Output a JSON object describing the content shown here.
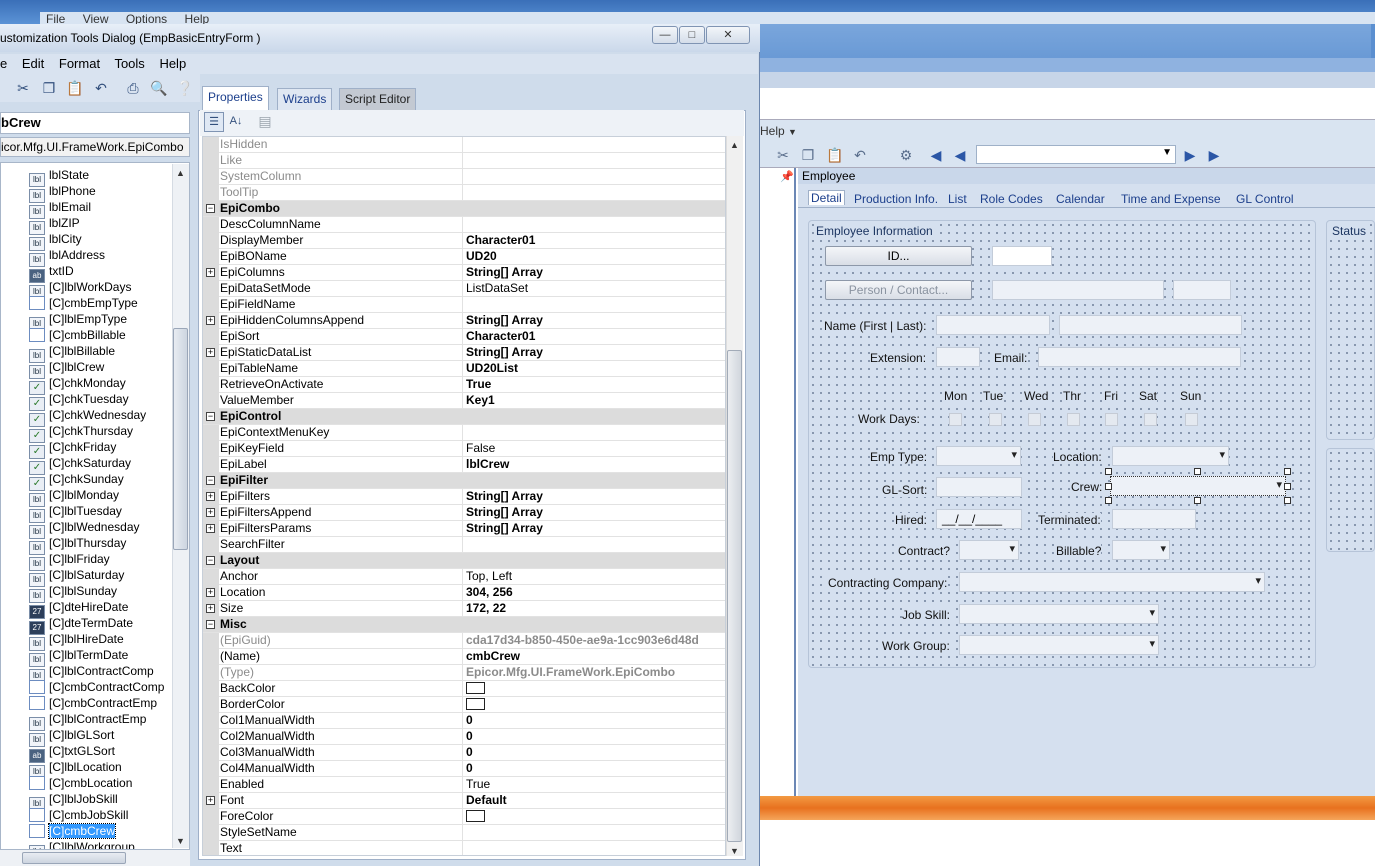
{
  "background_app": {
    "menu": [
      "File",
      "View",
      "Options",
      "Help"
    ],
    "help_label": "Help",
    "form_header": "Employee",
    "tabs": [
      "Detail",
      "Production Info.",
      "List",
      "Role Codes",
      "Calendar",
      "Time and Expense",
      "GL Control"
    ],
    "employee_panel_title": "Employee Information",
    "status_panel_title": "Status",
    "id_button": "ID...",
    "person_button": "Person / Contact...",
    "labels": {
      "name": "Name (First | Last):",
      "extension": "Extension:",
      "email": "Email:",
      "work_days": "Work Days:",
      "emp_type": "Emp Type:",
      "location": "Location:",
      "gl_sort": "GL-Sort:",
      "crew": "Crew:",
      "hired": "Hired:",
      "terminated": "Terminated:",
      "contract": "Contract?",
      "billable": "Billable?",
      "contracting_company": "Contracting Company:",
      "job_skill": "Job Skill:",
      "work_group": "Work Group:"
    },
    "days": [
      "Mon",
      "Tue",
      "Wed",
      "Thr",
      "Fri",
      "Sat",
      "Sun"
    ],
    "hired_mask": "__/__/____"
  },
  "dialog": {
    "title": "ustomization Tools Dialog  (EmpBasicEntryForm )",
    "menu": [
      "e",
      "Edit",
      "Format",
      "Tools",
      "Help"
    ],
    "window_buttons": {
      "minimize": "—",
      "restore": "□",
      "close": "✕"
    },
    "selected_control": "bCrew",
    "selected_type": "icor.Mfg.UI.FrameWork.EpiCombo",
    "tabs": [
      "Properties",
      "Wizards",
      "Script Editor"
    ],
    "tree_nodes": [
      {
        "label": "lblState",
        "icon": "label"
      },
      {
        "label": "lblPhone",
        "icon": "label"
      },
      {
        "label": "lblEmail",
        "icon": "label"
      },
      {
        "label": "lblZIP",
        "icon": "label"
      },
      {
        "label": "lblCity",
        "icon": "label"
      },
      {
        "label": "lblAddress",
        "icon": "label"
      },
      {
        "label": "txtID",
        "icon": "textbox"
      },
      {
        "label": "[C]lblWorkDays",
        "icon": "label"
      },
      {
        "label": "[C]cmbEmpType",
        "icon": "combo"
      },
      {
        "label": "[C]lblEmpType",
        "icon": "label"
      },
      {
        "label": "[C]cmbBillable",
        "icon": "combo"
      },
      {
        "label": "[C]lblBillable",
        "icon": "label"
      },
      {
        "label": "[C]lblCrew",
        "icon": "label"
      },
      {
        "label": "[C]chkMonday",
        "icon": "checkbox"
      },
      {
        "label": "[C]chkTuesday",
        "icon": "checkbox"
      },
      {
        "label": "[C]chkWednesday",
        "icon": "checkbox"
      },
      {
        "label": "[C]chkThursday",
        "icon": "checkbox"
      },
      {
        "label": "[C]chkFriday",
        "icon": "checkbox"
      },
      {
        "label": "[C]chkSaturday",
        "icon": "checkbox"
      },
      {
        "label": "[C]chkSunday",
        "icon": "checkbox"
      },
      {
        "label": "[C]lblMonday",
        "icon": "label"
      },
      {
        "label": "[C]lblTuesday",
        "icon": "label"
      },
      {
        "label": "[C]lblWednesday",
        "icon": "label"
      },
      {
        "label": "[C]lblThursday",
        "icon": "label"
      },
      {
        "label": "[C]lblFriday",
        "icon": "label"
      },
      {
        "label": "[C]lblSaturday",
        "icon": "label"
      },
      {
        "label": "[C]lblSunday",
        "icon": "label"
      },
      {
        "label": "[C]dteHireDate",
        "icon": "date"
      },
      {
        "label": "[C]dteTermDate",
        "icon": "date"
      },
      {
        "label": "[C]lblHireDate",
        "icon": "label"
      },
      {
        "label": "[C]lblTermDate",
        "icon": "label"
      },
      {
        "label": "[C]lblContractComp",
        "icon": "label"
      },
      {
        "label": "[C]cmbContractComp",
        "icon": "combo"
      },
      {
        "label": "[C]cmbContractEmp",
        "icon": "combo"
      },
      {
        "label": "[C]lblContractEmp",
        "icon": "label"
      },
      {
        "label": "[C]lblGLSort",
        "icon": "label"
      },
      {
        "label": "[C]txtGLSort",
        "icon": "textbox"
      },
      {
        "label": "[C]lblLocation",
        "icon": "label"
      },
      {
        "label": "[C]cmbLocation",
        "icon": "combo"
      },
      {
        "label": "[C]lblJobSkill",
        "icon": "label"
      },
      {
        "label": "[C]cmbJobSkill",
        "icon": "combo"
      },
      {
        "label": "[C]cmbCrew",
        "icon": "combo",
        "selected": true
      },
      {
        "label": "[C]lblWorkgroup",
        "icon": "label"
      }
    ],
    "properties": [
      {
        "name": "IsHidden",
        "value": "",
        "dim": true
      },
      {
        "name": "Like",
        "value": "",
        "dim": true
      },
      {
        "name": "SystemColumn",
        "value": "",
        "dim": true
      },
      {
        "name": "ToolTip",
        "value": "",
        "dim": true
      },
      {
        "category": "EpiCombo"
      },
      {
        "name": "DescColumnName",
        "value": ""
      },
      {
        "name": "DisplayMember",
        "value": "Character01",
        "bold": true
      },
      {
        "name": "EpiBOName",
        "value": "UD20",
        "bold": true
      },
      {
        "name": "EpiColumns",
        "value": "String[] Array",
        "bold": true,
        "expand": true
      },
      {
        "name": "EpiDataSetMode",
        "value": "ListDataSet"
      },
      {
        "name": "EpiFieldName",
        "value": ""
      },
      {
        "name": "EpiHiddenColumnsAppend",
        "value": "String[] Array",
        "bold": true,
        "expand": true
      },
      {
        "name": "EpiSort",
        "value": "Character01",
        "bold": true
      },
      {
        "name": "EpiStaticDataList",
        "value": "String[] Array",
        "bold": true,
        "expand": true
      },
      {
        "name": "EpiTableName",
        "value": "UD20List",
        "bold": true
      },
      {
        "name": "RetrieveOnActivate",
        "value": "True",
        "bold": true
      },
      {
        "name": "ValueMember",
        "value": "Key1",
        "bold": true
      },
      {
        "category": "EpiControl"
      },
      {
        "name": "EpiContextMenuKey",
        "value": ""
      },
      {
        "name": "EpiKeyField",
        "value": "False"
      },
      {
        "name": "EpiLabel",
        "value": "lblCrew",
        "bold": true
      },
      {
        "category": "EpiFilter"
      },
      {
        "name": "EpiFilters",
        "value": "String[] Array",
        "bold": true,
        "expand": true
      },
      {
        "name": "EpiFiltersAppend",
        "value": "String[] Array",
        "bold": true,
        "expand": true
      },
      {
        "name": "EpiFiltersParams",
        "value": "String[] Array",
        "bold": true,
        "expand": true
      },
      {
        "name": "SearchFilter",
        "value": ""
      },
      {
        "category": "Layout"
      },
      {
        "name": "Anchor",
        "value": "Top, Left"
      },
      {
        "name": "Location",
        "value": "304, 256",
        "bold": true,
        "expand": true
      },
      {
        "name": "Size",
        "value": "172, 22",
        "bold": true,
        "expand": true
      },
      {
        "category": "Misc"
      },
      {
        "name": "(EpiGuid)",
        "value": "cda17d34-b850-450e-ae9a-1cc903e6d48d",
        "bold": true,
        "dim": true
      },
      {
        "name": "(Name)",
        "value": "cmbCrew",
        "bold": true
      },
      {
        "name": "(Type)",
        "value": "Epicor.Mfg.UI.FrameWork.EpiCombo",
        "bold": true,
        "dim": true
      },
      {
        "name": "BackColor",
        "value": "",
        "swatch": true
      },
      {
        "name": "BorderColor",
        "value": "",
        "swatch": true
      },
      {
        "name": "Col1ManualWidth",
        "value": "0",
        "bold": true
      },
      {
        "name": "Col2ManualWidth",
        "value": "0",
        "bold": true
      },
      {
        "name": "Col3ManualWidth",
        "value": "0",
        "bold": true
      },
      {
        "name": "Col4ManualWidth",
        "value": "0",
        "bold": true
      },
      {
        "name": "Enabled",
        "value": "True"
      },
      {
        "name": "Font",
        "value": "Default",
        "bold": true,
        "expand": true
      },
      {
        "name": "ForeColor",
        "value": "",
        "swatch": true
      },
      {
        "name": "StyleSetName",
        "value": ""
      },
      {
        "name": "Text",
        "value": ""
      }
    ]
  }
}
